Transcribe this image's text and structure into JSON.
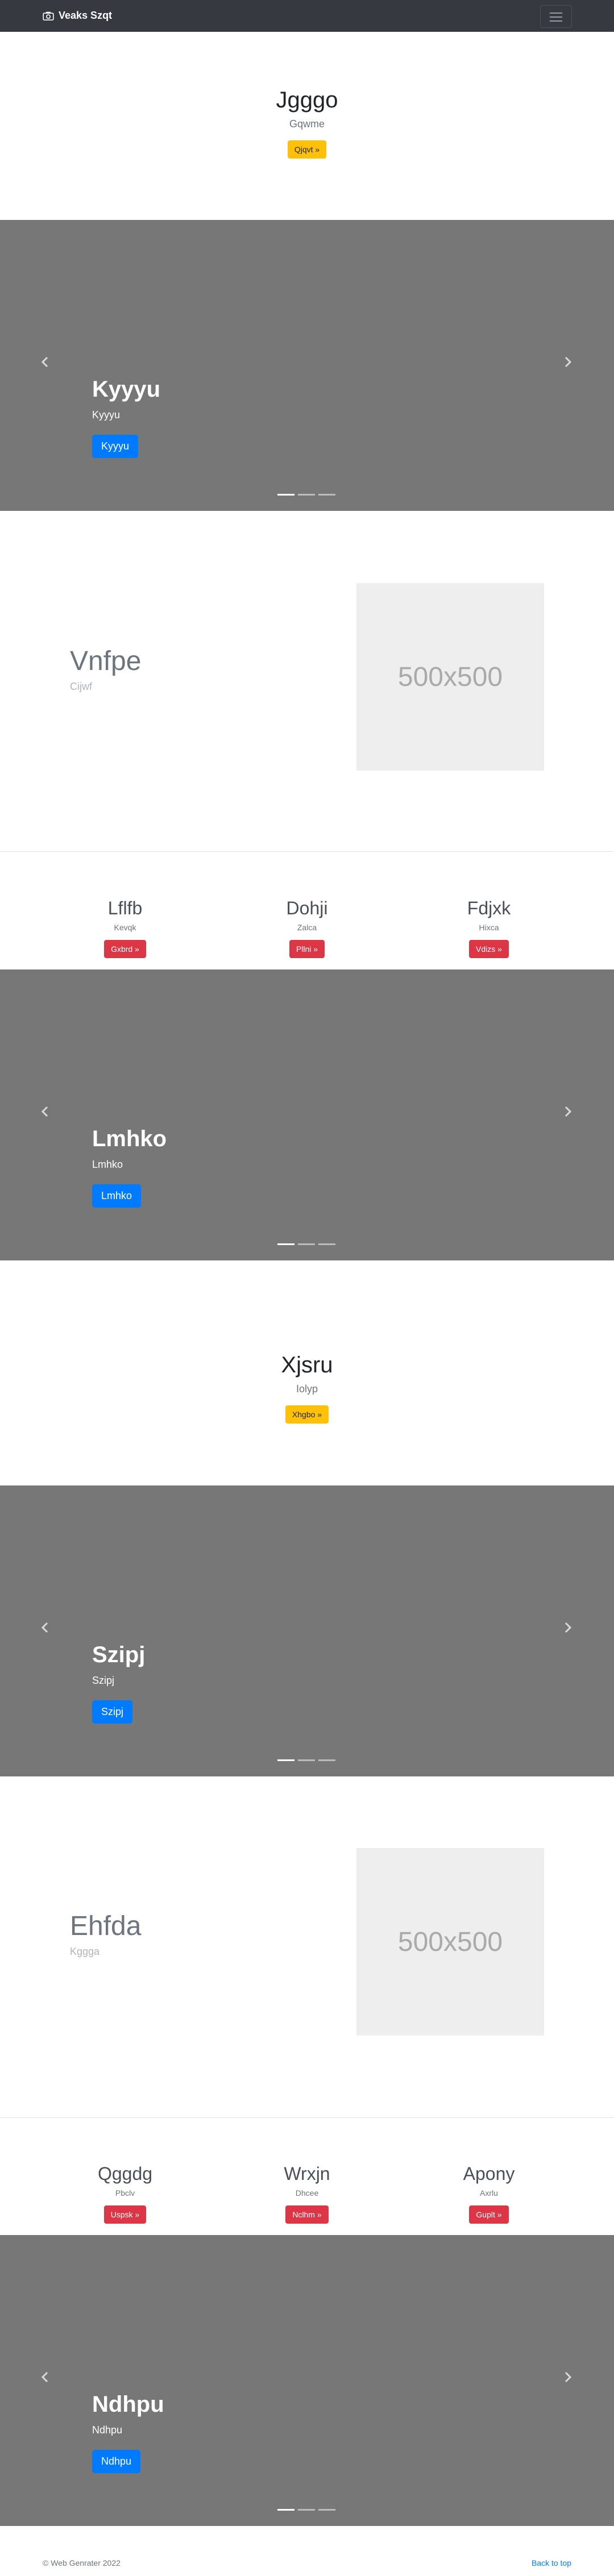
{
  "navbar": {
    "brand": "Veaks Szqt",
    "camera_icon": "camera-icon",
    "toggler_icon": "hamburger-icon"
  },
  "hero1": {
    "title": "Jgggo",
    "subtitle": "Gqwme",
    "button": "Qjqvt »"
  },
  "carousel1": {
    "title": "Kyyyu",
    "text": "Kyyyu",
    "button": "Kyyyu",
    "slides": 3,
    "active_slide": 1
  },
  "feature1": {
    "title": "Vnfpe",
    "subtitle": "Cijwf",
    "image_label": "500x500"
  },
  "columns1": [
    {
      "title": "Lflfb",
      "text": "Kevqk",
      "button": "Gxbrd »"
    },
    {
      "title": "Dohji",
      "text": "Zalca",
      "button": "Pllni »"
    },
    {
      "title": "Fdjxk",
      "text": "Hixca",
      "button": "Vdizs »"
    }
  ],
  "carousel2": {
    "title": "Lmhko",
    "text": "Lmhko",
    "button": "Lmhko",
    "slides": 3,
    "active_slide": 1
  },
  "hero2": {
    "title": "Xjsru",
    "subtitle": "Iolyp",
    "button": "Xhgbo »"
  },
  "carousel3": {
    "title": "Szipj",
    "text": "Szipj",
    "button": "Szipj",
    "slides": 3,
    "active_slide": 1
  },
  "feature2": {
    "title": "Ehfda",
    "subtitle": "Kggga",
    "image_label": "500x500"
  },
  "columns2": [
    {
      "title": "Qggdg",
      "text": "Pbclv",
      "button": "Uspsk »"
    },
    {
      "title": "Wrxjn",
      "text": "Dhcee",
      "button": "Nclhm »"
    },
    {
      "title": "Apony",
      "text": "Axrlu",
      "button": "Guplt »"
    }
  ],
  "carousel4": {
    "title": "Ndhpu",
    "text": "Ndhpu",
    "button": "Ndhpu",
    "slides": 3,
    "active_slide": 1
  },
  "footer": {
    "copyright": "© Web Genrater 2022",
    "back_to_top": "Back to top"
  },
  "colors": {
    "navbar": "#343a40",
    "carousel_bg": "#777777",
    "primary": "#007bff",
    "warning": "#ffc107",
    "danger": "#dc3545"
  }
}
